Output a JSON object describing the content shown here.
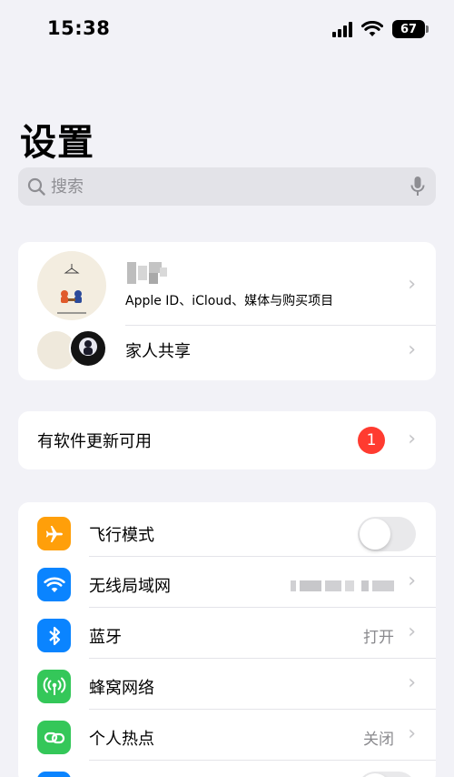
{
  "status_bar": {
    "time": "15:38",
    "battery": "67"
  },
  "page_title": "设置",
  "search": {
    "placeholder": "搜索"
  },
  "apple_id": {
    "subtitle": "Apple ID、iCloud、媒体与购买项目",
    "family_label": "家人共享"
  },
  "update": {
    "label": "有软件更新可用",
    "badge_count": "1"
  },
  "settings": {
    "airplane": {
      "label": "飞行模式",
      "enabled": false
    },
    "wifi": {
      "label": "无线局域网"
    },
    "bluetooth": {
      "label": "蓝牙",
      "value": "打开"
    },
    "cellular": {
      "label": "蜂窝网络"
    },
    "hotspot": {
      "label": "个人热点",
      "value": "关闭"
    }
  },
  "colors": {
    "airplane": "#ff9f0a",
    "wifi": "#0a84ff",
    "bluetooth": "#0a84ff",
    "cellular": "#34c759",
    "hotspot": "#34c759",
    "badge": "#ff3b30"
  },
  "icons": {
    "search": "magnifier-icon",
    "mic": "mic-icon",
    "chevron": "chevron-right-icon"
  }
}
